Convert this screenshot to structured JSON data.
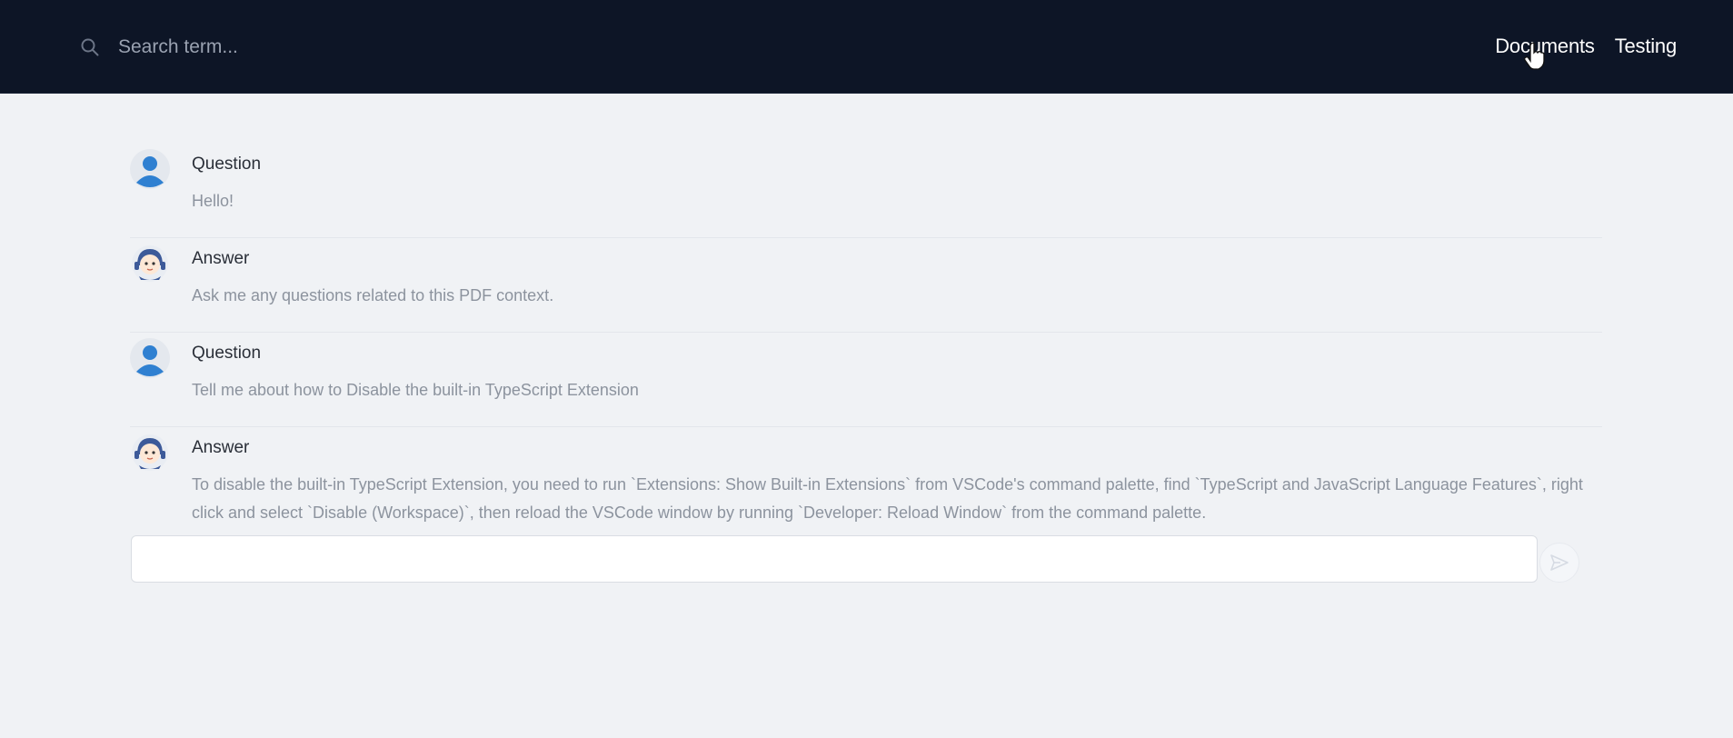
{
  "header": {
    "search": {
      "placeholder": "Search term..."
    },
    "nav": [
      {
        "label": "Documents"
      },
      {
        "label": "Testing"
      }
    ]
  },
  "chat": {
    "messages": [
      {
        "role": "Question",
        "text": "Hello!",
        "avatar": "user-avatar-icon"
      },
      {
        "role": "Answer",
        "text": "Ask me any questions related to this PDF context.",
        "avatar": "bot-avatar-icon"
      },
      {
        "role": "Question",
        "text": "Tell me about how to Disable the built-in TypeScript Extension",
        "avatar": "user-avatar-icon"
      },
      {
        "role": "Answer",
        "text": "To disable the built-in TypeScript Extension, you need to run `Extensions: Show Built-in Extensions` from VSCode's command palette, find `TypeScript and JavaScript Language Features`, right click and select `Disable (Workspace)`, then reload the VSCode window by running `Developer: Reload Window` from the command palette.",
        "avatar": "bot-avatar-icon"
      }
    ],
    "input": {
      "value": "",
      "send_icon": "send-icon"
    }
  },
  "colors": {
    "header_bg": "#0d1526",
    "page_bg": "#f0f2f5",
    "user_avatar": "#2f80d1",
    "bot_avatar": "#3d5a99"
  }
}
